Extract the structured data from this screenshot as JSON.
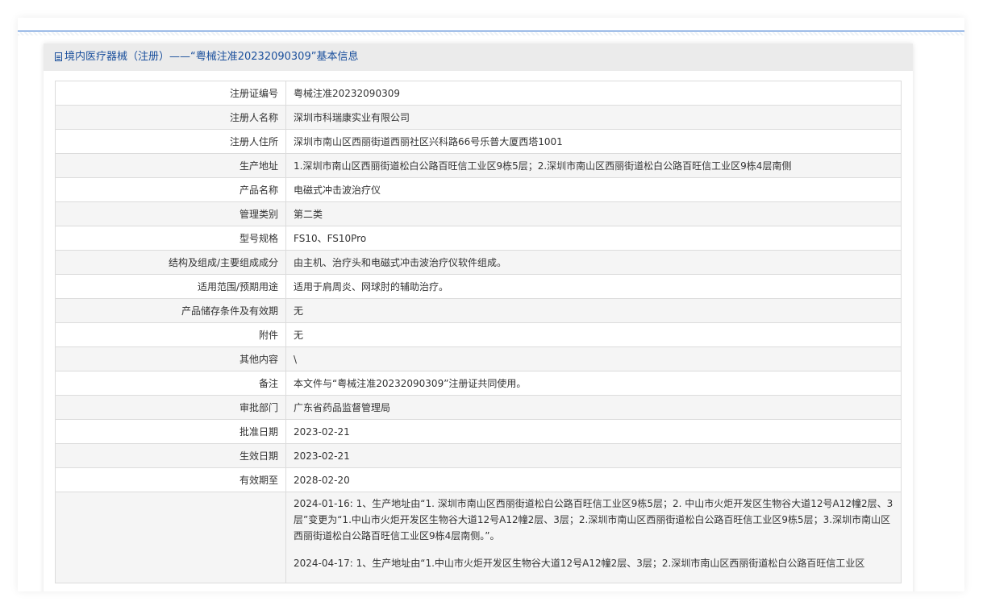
{
  "header": {
    "title": "境内医疗器械（注册）——“粤械注准20232090309”基本信息"
  },
  "rows": [
    {
      "label": "注册证编号",
      "value": "粤械注准20232090309"
    },
    {
      "label": "注册人名称",
      "value": "深圳市科瑞康实业有限公司"
    },
    {
      "label": "注册人住所",
      "value": "深圳市南山区西丽街道西丽社区兴科路66号乐普大厦西塔1001"
    },
    {
      "label": "生产地址",
      "value": "1.深圳市南山区西丽街道松白公路百旺信工业区9栋5层；2.深圳市南山区西丽街道松白公路百旺信工业区9栋4层南侧"
    },
    {
      "label": "产品名称",
      "value": "电磁式冲击波治疗仪"
    },
    {
      "label": "管理类别",
      "value": "第二类"
    },
    {
      "label": "型号规格",
      "value": "FS10、FS10Pro"
    },
    {
      "label": "结构及组成/主要组成成分",
      "value": "由主机、治疗头和电磁式冲击波治疗仪软件组成。"
    },
    {
      "label": "适用范围/预期用途",
      "value": "适用于肩周炎、网球肘的辅助治疗。"
    },
    {
      "label": "产品储存条件及有效期",
      "value": "无"
    },
    {
      "label": "附件",
      "value": "无"
    },
    {
      "label": "其他内容",
      "value": "\\"
    },
    {
      "label": "备注",
      "value": "本文件与“粤械注准20232090309”注册证共同使用。"
    },
    {
      "label": "审批部门",
      "value": "广东省药品监督管理局"
    },
    {
      "label": "批准日期",
      "value": "2023-02-21"
    },
    {
      "label": "生效日期",
      "value": "2023-02-21"
    },
    {
      "label": "有效期至",
      "value": "2028-02-20"
    }
  ],
  "change_notes": [
    "2024-01-16: 1、生产地址由“1. 深圳市南山区西丽街道松白公路百旺信工业区9栋5层；2. 中山市火炬开发区生物谷大道12号A12幢2层、3层”变更为“1.中山市火炬开发区生物谷大道12号A12幢2层、3层；2.深圳市南山区西丽街道松白公路百旺信工业区9栋5层；3.深圳市南山区西丽街道松白公路百旺信工业区9栋4层南侧。”。",
    "2024-04-17: 1、生产地址由“1.中山市火炬开发区生物谷大道12号A12幢2层、3层；2.深圳市南山区西丽街道松白公路百旺信工业区"
  ]
}
